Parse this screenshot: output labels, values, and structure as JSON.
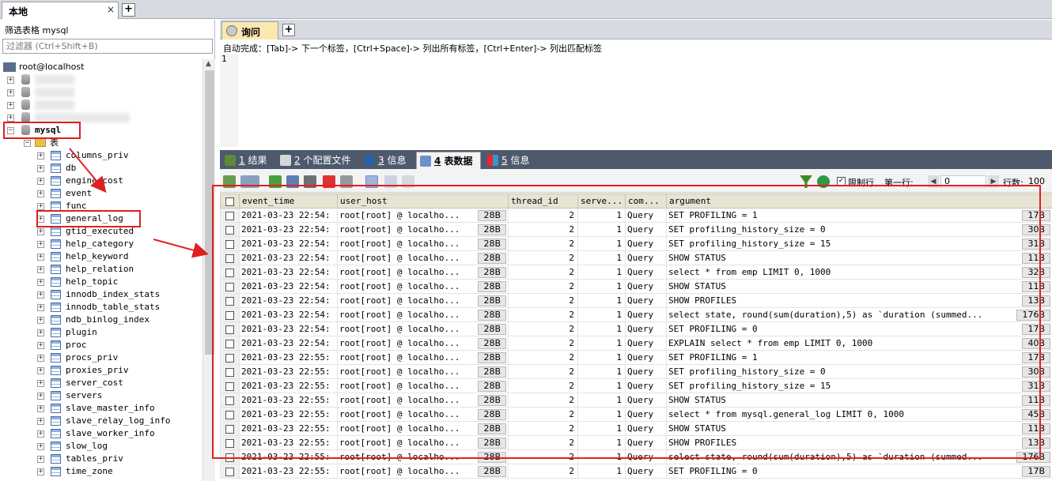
{
  "top_tab": {
    "label": "本地",
    "close": "×",
    "add": "+"
  },
  "left": {
    "filter_label": "筛选表格 mysql",
    "filter_placeholder": "过滤器 (Ctrl+Shift+B)",
    "root": "root@localhost",
    "mysql_db": "mysql",
    "tables_folder": "表",
    "tables": [
      "columns_priv",
      "db",
      "engine_cost",
      "event",
      "func",
      "general_log",
      "gtid_executed",
      "help_category",
      "help_keyword",
      "help_relation",
      "help_topic",
      "innodb_index_stats",
      "innodb_table_stats",
      "ndb_binlog_index",
      "plugin",
      "proc",
      "procs_priv",
      "proxies_priv",
      "server_cost",
      "servers",
      "slave_master_info",
      "slave_relay_log_info",
      "slave_worker_info",
      "slow_log",
      "tables_priv",
      "time_zone"
    ]
  },
  "query": {
    "tab_label": "询问",
    "add": "+",
    "hint": "自动完成：[Tab]-> 下一个标签，[Ctrl+Space]-> 列出所有标签，[Ctrl+Enter]-> 列出匹配标签",
    "line_number": "1"
  },
  "result_tabs": [
    {
      "num": "1",
      "label": "结果"
    },
    {
      "num": "2",
      "label": "个配置文件"
    },
    {
      "num": "3",
      "label": "信息"
    },
    {
      "num": "4",
      "label": "表数据"
    },
    {
      "num": "5",
      "label": "信息"
    }
  ],
  "toolbar": {
    "limit_label": "限制行",
    "first_row_label": "第一行:",
    "first_row_value": "0",
    "rows_label": "行数:",
    "rows_value": "100"
  },
  "grid": {
    "columns": [
      "event_time",
      "user_host",
      "thread_id",
      "serve...",
      "com...",
      "argument"
    ],
    "rows": [
      [
        "2021-03-23 22:54:",
        "root[root] @ localho...",
        "28B",
        "2",
        "1",
        "Query",
        "SET PROFILING = 1",
        "17B"
      ],
      [
        "2021-03-23 22:54:",
        "root[root] @ localho...",
        "28B",
        "2",
        "1",
        "Query",
        "SET profiling_history_size = 0",
        "30B"
      ],
      [
        "2021-03-23 22:54:",
        "root[root] @ localho...",
        "28B",
        "2",
        "1",
        "Query",
        "SET profiling_history_size = 15",
        "31B"
      ],
      [
        "2021-03-23 22:54:",
        "root[root] @ localho...",
        "28B",
        "2",
        "1",
        "Query",
        "SHOW STATUS",
        "11B"
      ],
      [
        "2021-03-23 22:54:",
        "root[root] @ localho...",
        "28B",
        "2",
        "1",
        "Query",
        "select * from emp LIMIT 0, 1000",
        "32B"
      ],
      [
        "2021-03-23 22:54:",
        "root[root] @ localho...",
        "28B",
        "2",
        "1",
        "Query",
        "SHOW STATUS",
        "11B"
      ],
      [
        "2021-03-23 22:54:",
        "root[root] @ localho...",
        "28B",
        "2",
        "1",
        "Query",
        "SHOW PROFILES",
        "13B"
      ],
      [
        "2021-03-23 22:54:",
        "root[root] @ localho...",
        "28B",
        "2",
        "1",
        "Query",
        "select state, round(sum(duration),5) as `duration (summed...",
        "176B"
      ],
      [
        "2021-03-23 22:54:",
        "root[root] @ localho...",
        "28B",
        "2",
        "1",
        "Query",
        "SET PROFILING = 0",
        "17B"
      ],
      [
        "2021-03-23 22:54:",
        "root[root] @ localho...",
        "28B",
        "2",
        "1",
        "Query",
        "EXPLAIN select * from emp LIMIT 0, 1000",
        "40B"
      ],
      [
        "2021-03-23 22:55:",
        "root[root] @ localho...",
        "28B",
        "2",
        "1",
        "Query",
        "SET PROFILING = 1",
        "17B"
      ],
      [
        "2021-03-23 22:55:",
        "root[root] @ localho...",
        "28B",
        "2",
        "1",
        "Query",
        "SET profiling_history_size = 0",
        "30B"
      ],
      [
        "2021-03-23 22:55:",
        "root[root] @ localho...",
        "28B",
        "2",
        "1",
        "Query",
        "SET profiling_history_size = 15",
        "31B"
      ],
      [
        "2021-03-23 22:55:",
        "root[root] @ localho...",
        "28B",
        "2",
        "1",
        "Query",
        "SHOW STATUS",
        "11B"
      ],
      [
        "2021-03-23 22:55:",
        "root[root] @ localho...",
        "28B",
        "2",
        "1",
        "Query",
        "select * from mysql.general_log LIMIT 0, 1000",
        "45B"
      ],
      [
        "2021-03-23 22:55:",
        "root[root] @ localho...",
        "28B",
        "2",
        "1",
        "Query",
        "SHOW STATUS",
        "11B"
      ],
      [
        "2021-03-23 22:55:",
        "root[root] @ localho...",
        "28B",
        "2",
        "1",
        "Query",
        "SHOW PROFILES",
        "13B"
      ],
      [
        "2021-03-23 22:55:",
        "root[root] @ localho...",
        "28B",
        "2",
        "1",
        "Query",
        "select state, round(sum(duration),5) as `duration (summed...",
        "176B"
      ],
      [
        "2021-03-23 22:55:",
        "root[root] @ localho...",
        "28B",
        "2",
        "1",
        "Query",
        "SET PROFILING = 0",
        "17B"
      ]
    ]
  },
  "colors": {
    "annotation": "#e02020",
    "result_tabbar": "#4e5a6c",
    "active_query_tab": "#fbe7b0"
  }
}
